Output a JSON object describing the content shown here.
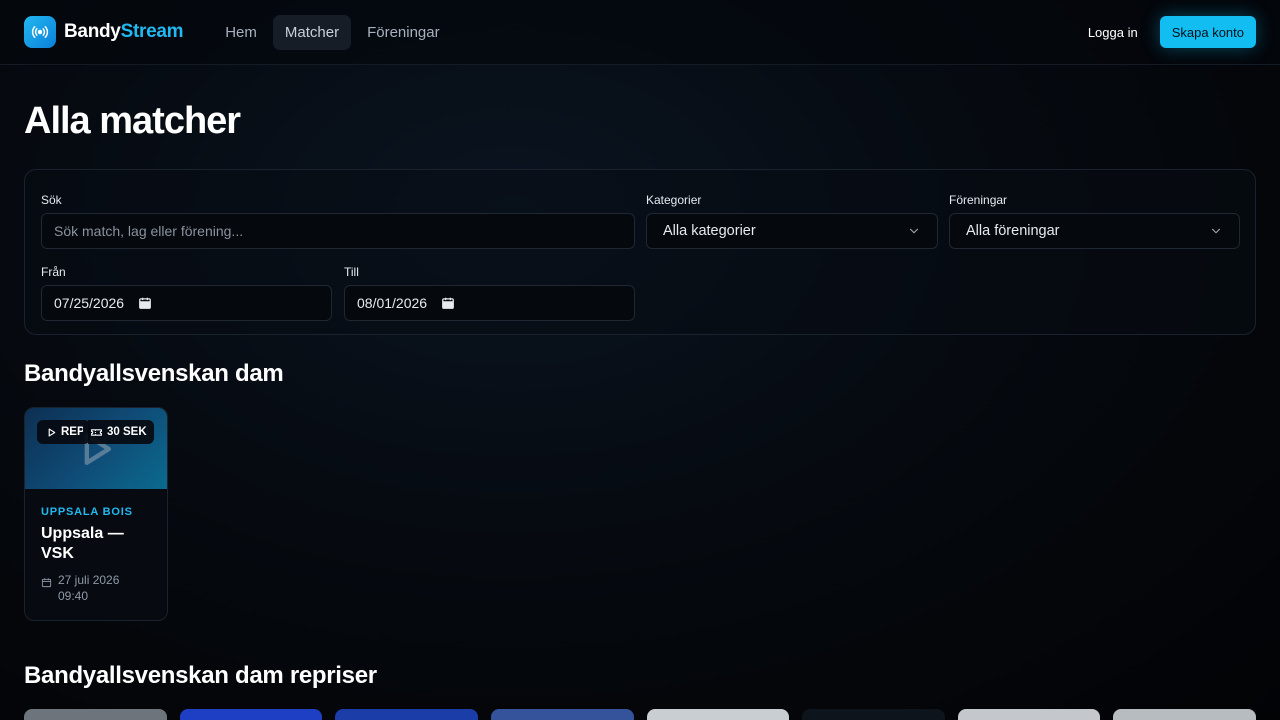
{
  "brand": {
    "name_part1": "Bandy",
    "name_part2": "Stream",
    "accent": "#22b8f0"
  },
  "nav": {
    "items": [
      {
        "label": "Hem",
        "active": false
      },
      {
        "label": "Matcher",
        "active": true
      },
      {
        "label": "Föreningar",
        "active": false
      }
    ]
  },
  "auth": {
    "login_label": "Logga in",
    "signup_label": "Skapa konto"
  },
  "page": {
    "title": "Alla matcher"
  },
  "filters": {
    "search_label": "Sök",
    "search_placeholder": "Sök match, lag eller förening...",
    "categories_label": "Kategorier",
    "categories_value": "Alla kategorier",
    "clubs_label": "Föreningar",
    "clubs_value": "Alla föreningar",
    "from_label": "Från",
    "from_value": "07/25/2026",
    "to_label": "Till",
    "to_value": "08/01/2026"
  },
  "sections": [
    {
      "title": "Bandyallsvenskan dam",
      "cards": [
        {
          "badge_label": "REPRIS",
          "price": "30 SEK",
          "club": "UPPSALA BOIS",
          "title": "Uppsala — VSK",
          "date": "27 juli 2026",
          "time": "09:40"
        }
      ]
    },
    {
      "title": "Bandyallsvenskan dam repriser"
    }
  ],
  "icons": {
    "logo": "broadcast-icon",
    "select": "chevron-down-icon",
    "date": "calendar-icon",
    "play": "play-icon",
    "ticket": "ticket-icon"
  }
}
